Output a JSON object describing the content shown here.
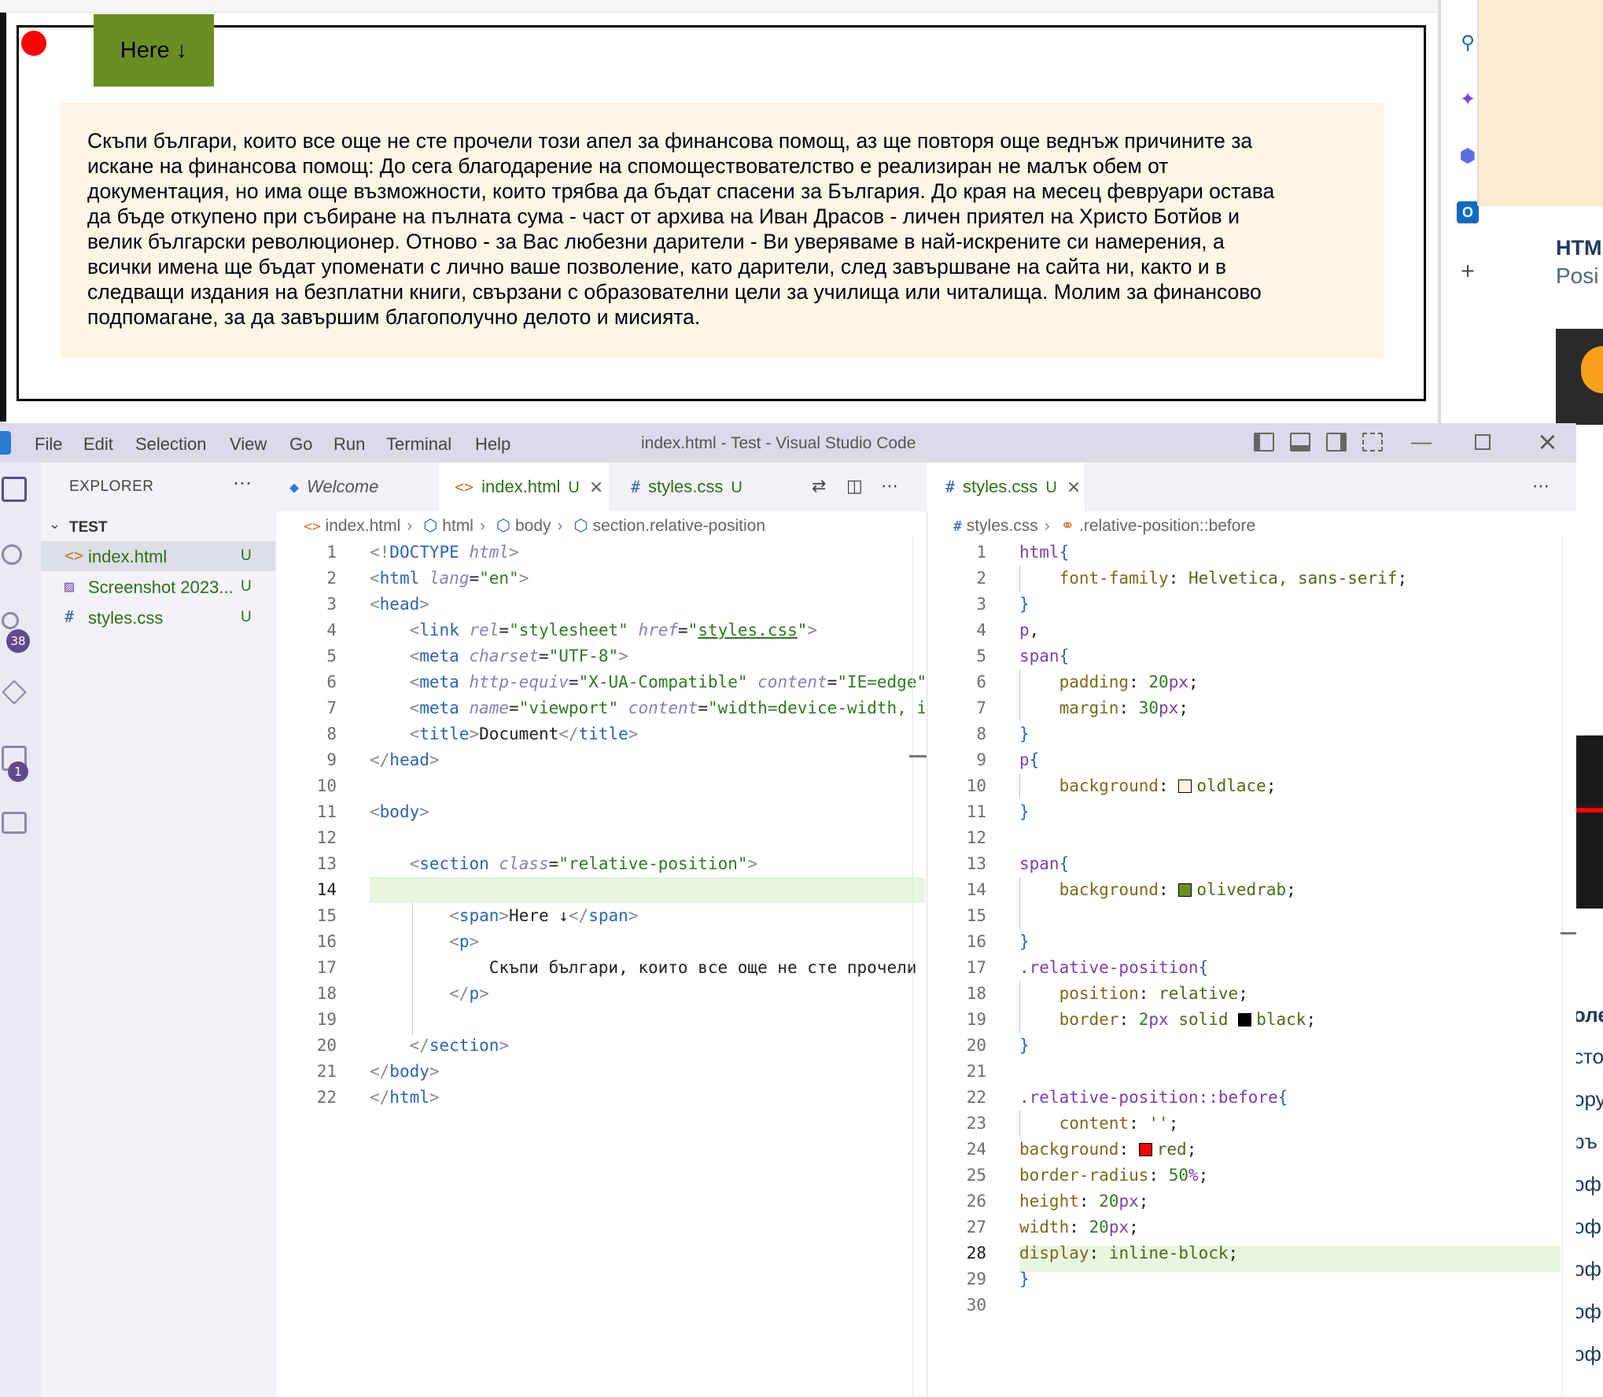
{
  "preview": {
    "span_text": "Here ↓",
    "paragraph_lines": [
      "Скъпи българи, които все още не сте прочели този апел за финансова помощ, аз ще повторя още веднъж причините за",
      "искане на финансова помощ: До сега благодарение на спомоществователство е реализиран не малък обем от",
      "документация, но има още възможности, които трябва да бъдат спасени за България. До края на месец февруари остава",
      "да бъде откупено при събиране на пълната сума - част от архива на Иван Драсов - личен приятел на Христо Ботйов и",
      "велик български революционер. Отново - за Вас любезни дарители - Ви уверяваме в най-искрените си намерения, а",
      "всички имена ще бъдат упоменати с лично ваше позволение, като дарители, след завършване на сайта ни, както и в",
      "следващи издания на безплатни книги, свързани с образователни цели за училища или читалища. Молим за финансово",
      "подпомагане, за да завършим благополучно делото и мисията."
    ]
  },
  "right_side": {
    "html_label": "HTML",
    "pos_label": "Posi",
    "fragments": [
      "оле",
      "сто",
      "ору",
      "ръ",
      "оф",
      "оф",
      "оф",
      "оф",
      "оф"
    ]
  },
  "vscode": {
    "menu": [
      "File",
      "Edit",
      "Selection",
      "View",
      "Go",
      "Run",
      "Terminal",
      "Help"
    ],
    "window_title": "index.html - Test - Visual Studio Code",
    "badges": {
      "source_control": "38",
      "extensions": "1"
    },
    "explorer_title": "EXPLORER",
    "folder_name": "TEST",
    "files": [
      {
        "name": "index.html",
        "status": "U",
        "icon": "<>"
      },
      {
        "name": "Screenshot 2023...",
        "status": "U",
        "icon": "▨"
      },
      {
        "name": "styles.css",
        "status": "U",
        "icon": "#"
      }
    ],
    "editor1": {
      "tabs": [
        {
          "label": "Welcome",
          "status": ""
        },
        {
          "label": "index.html",
          "status": "U"
        },
        {
          "label": "styles.css",
          "status": "U"
        }
      ],
      "breadcrumbs": [
        "index.html",
        "html",
        "body",
        "section.relative-position"
      ],
      "line_numbers": [
        "1",
        "2",
        "3",
        "4",
        "5",
        "6",
        "7",
        "8",
        "9",
        "10",
        "11",
        "12",
        "13",
        "14",
        "15",
        "16",
        "17",
        "18",
        "19",
        "20",
        "21",
        "22"
      ],
      "current_line": "14"
    },
    "editor2": {
      "tab": {
        "label": "styles.css",
        "status": "U"
      },
      "breadcrumbs": [
        "styles.css",
        ".relative-position::before"
      ],
      "line_numbers": [
        "1",
        "2",
        "3",
        "4",
        "5",
        "6",
        "7",
        "8",
        "9",
        "10",
        "11",
        "12",
        "13",
        "14",
        "15",
        "16",
        "17",
        "18",
        "19",
        "20",
        "21",
        "22",
        "23",
        "24",
        "25",
        "26",
        "27",
        "28",
        "29",
        "30"
      ],
      "current_line": "28"
    },
    "colors": {
      "accent": "#5b4d8c",
      "untracked": "#2f6f15",
      "olivedrab": "#6b8e23",
      "oldlace": "#fdf5e6",
      "red": "#ff0000"
    }
  }
}
